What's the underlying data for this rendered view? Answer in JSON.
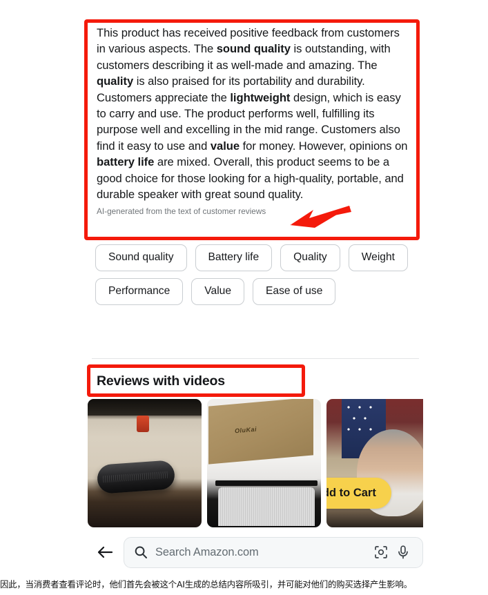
{
  "summary": {
    "paragraph_plain": "This product has received positive feedback from customers in various aspects. The sound quality is outstanding, with customers describing it as well-made and amazing. The quality is also praised for its portability and durability. Customers appreciate the lightweight design, which is easy to carry and use. The product performs well, fulfilling its purpose well and excelling in the mid range. Customers also find it easy to use and value for money. However, opinions on battery life are mixed. Overall, this product seems to be a good choice for those looking for a high-quality, portable, and durable speaker with great sound quality.",
    "segments": [
      {
        "text": "This product has received positive feedback from customers in various aspects. The ",
        "bold": false
      },
      {
        "text": "sound quality",
        "bold": true
      },
      {
        "text": " is outstanding, with customers describing it as well-made and amazing. The ",
        "bold": false
      },
      {
        "text": "quality",
        "bold": true
      },
      {
        "text": " is also praised for its portability and durability. Customers appreciate the ",
        "bold": false
      },
      {
        "text": "lightweight",
        "bold": true
      },
      {
        "text": " design, which is easy to carry and use. The product performs well, fulfilling its purpose well and excelling in the mid range. Customers also find it easy to use and ",
        "bold": false
      },
      {
        "text": "value",
        "bold": true
      },
      {
        "text": " for money. However, opinions on ",
        "bold": false
      },
      {
        "text": "battery life",
        "bold": true
      },
      {
        "text": " are mixed. Overall, this product seems to be a good choice for those looking for a high-quality, portable, and durable speaker with great sound quality.",
        "bold": false
      }
    ],
    "footnote": "AI-generated from the text of customer reviews"
  },
  "chips": [
    {
      "label": "Sound quality"
    },
    {
      "label": "Battery life"
    },
    {
      "label": "Quality"
    },
    {
      "label": "Weight"
    },
    {
      "label": "Performance"
    },
    {
      "label": "Value"
    },
    {
      "label": "Ease of use"
    }
  ],
  "reviews_section": {
    "heading": "Reviews with videos",
    "thumbnails": [
      {
        "alt": "Black portable speaker on a carpeted table"
      },
      {
        "alt": "Cardboard shipping box held over a white speaker"
      },
      {
        "alt": "Man reviewing on camera with flag backdrop"
      }
    ],
    "box_brand_text": "OluKai",
    "add_to_cart_label": "Add to Cart"
  },
  "bottom_bar": {
    "back_icon": "arrow-left-icon",
    "search_icon": "search-icon",
    "search_placeholder": "Search Amazon.com",
    "search_value": "",
    "camera_icon": "camera-scan-icon",
    "mic_icon": "microphone-icon"
  },
  "annotations": {
    "summary_highlight": "red-rectangle",
    "reviews_highlight": "red-rectangle",
    "arrow": "red-arrow-pointing-to-ai-generated-note",
    "accent_red": "#f41a0b",
    "accent_yellow": "#f7d14c"
  },
  "caption": {
    "text": "因此，当消费者查看评论时，他们首先会被这个AI生成的总结内容所吸引，并可能对他们的购买选择产生影响。"
  }
}
